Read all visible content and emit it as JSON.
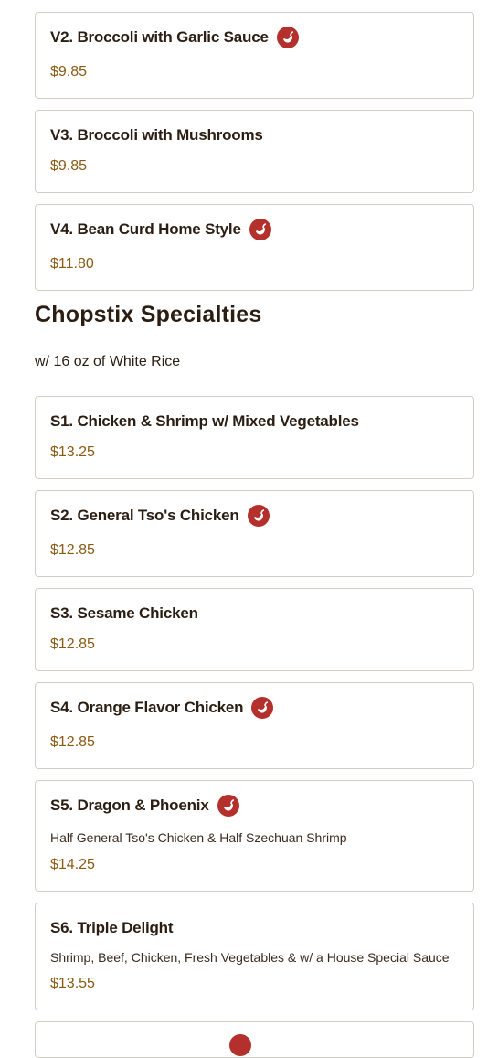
{
  "colors": {
    "price": "#8a5a12",
    "spicy_badge": "#b3302c",
    "border": "#d3cdc6",
    "text": "#2b1d12"
  },
  "vegetables": {
    "items": [
      {
        "name": "V2. Broccoli with Garlic Sauce",
        "spicy": true,
        "price": "$9.85"
      },
      {
        "name": "V3. Broccoli with Mushrooms",
        "spicy": false,
        "price": "$9.85"
      },
      {
        "name": "V4. Bean Curd Home Style",
        "spicy": true,
        "price": "$11.80"
      }
    ]
  },
  "specialties": {
    "title": "Chopstix Specialties",
    "note": "w/ 16 oz of White Rice",
    "items": [
      {
        "name": "S1. Chicken & Shrimp w/ Mixed Vegetables",
        "spicy": false,
        "price": "$13.25"
      },
      {
        "name": "S2. General Tso's Chicken",
        "spicy": true,
        "price": "$12.85"
      },
      {
        "name": "S3. Sesame Chicken",
        "spicy": false,
        "price": "$12.85"
      },
      {
        "name": "S4. Orange Flavor Chicken",
        "spicy": true,
        "price": "$12.85"
      },
      {
        "name": "S5. Dragon & Phoenix",
        "spicy": true,
        "description": "Half General Tso's Chicken & Half Szechuan Shrimp",
        "price": "$14.25"
      },
      {
        "name": "S6. Triple Delight",
        "spicy": false,
        "description": "Shrimp, Beef, Chicken, Fresh Vegetables & w/ a House Special Sauce",
        "price": "$13.55"
      }
    ]
  },
  "icons": {
    "spicy": "chili-pepper-icon"
  }
}
